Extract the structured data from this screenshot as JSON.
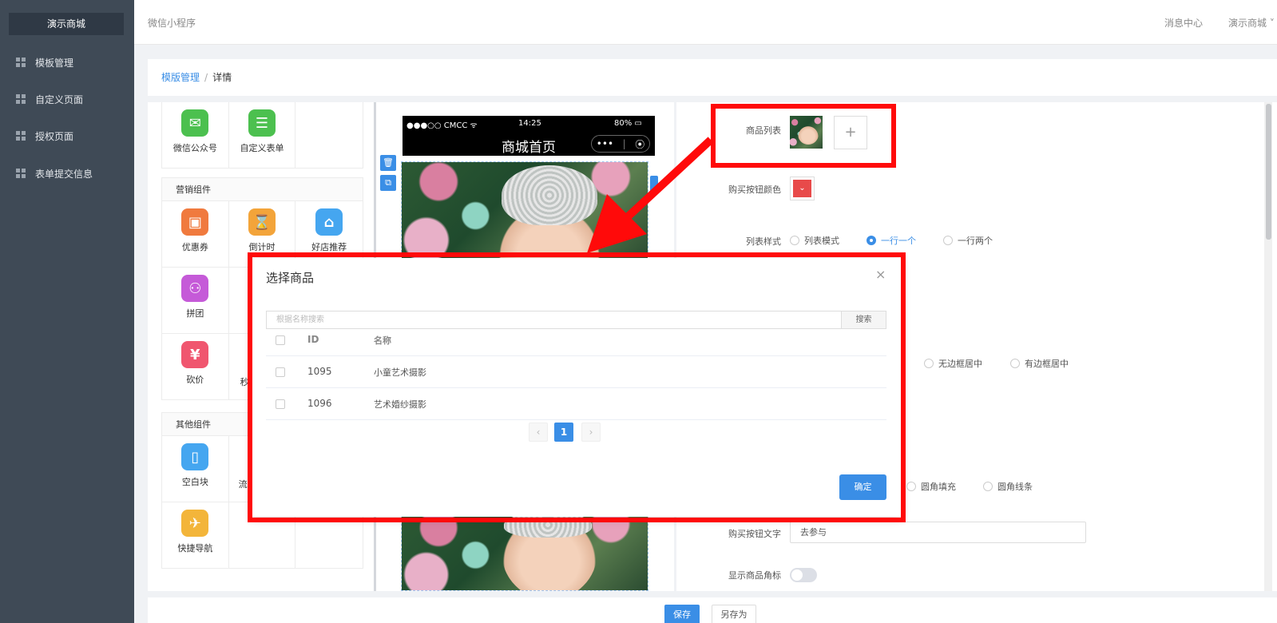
{
  "sidebar": {
    "brand": "演示商城",
    "items": [
      {
        "label": "模板管理"
      },
      {
        "label": "自定义页面"
      },
      {
        "label": "授权页面"
      },
      {
        "label": "表单提交信息"
      }
    ]
  },
  "header": {
    "app_name": "微信小程序",
    "message_center": "消息中心",
    "shop_menu": "演示商城 ˅"
  },
  "breadcrumb": {
    "parent": "模版管理",
    "separator": "/",
    "current": "详情"
  },
  "components": {
    "top_row": [
      {
        "label": "微信公众号",
        "icon": "wechat-icon",
        "color": "#4cc04f"
      },
      {
        "label": "自定义表单",
        "icon": "form-icon",
        "color": "#4cc04f"
      }
    ],
    "marketing_title": "营销组件",
    "marketing_rows": [
      [
        {
          "label": "优惠券",
          "icon": "coupon-icon",
          "color": "#f07a3e"
        },
        {
          "label": "倒计时",
          "icon": "hourglass-icon",
          "color": "#f3a43a"
        },
        {
          "label": "好店推荐",
          "icon": "shop-icon",
          "color": "#45a6f0"
        }
      ],
      [
        {
          "label": "拼团",
          "icon": "group-icon",
          "color": "#c55ad8"
        }
      ],
      [
        {
          "label": "砍价",
          "icon": "yen-icon",
          "color": "#f0566f"
        },
        {
          "label": "秒",
          "icon": "",
          "color": ""
        }
      ]
    ],
    "other_title": "其他组件",
    "other_rows": [
      [
        {
          "label": "空白块",
          "icon": "blank-icon",
          "color": "#45a6f0"
        },
        {
          "label": "流",
          "icon": "",
          "color": ""
        }
      ],
      [
        {
          "label": "快捷导航",
          "icon": "compass-icon",
          "color": "#f3b53a"
        }
      ]
    ]
  },
  "phone": {
    "carrier": "●●●○○ CMCC ᯤ",
    "time": "14:25",
    "battery": "80% ▭",
    "page_title": "商城首页",
    "capsule_more": "•••",
    "capsule_close": "⦿",
    "delete_icon": "🗑",
    "copy_icon": "⧉"
  },
  "config": {
    "goods_list_label": "商品列表",
    "add_symbol": "+",
    "buy_color_label": "购买按钮颜色",
    "buy_color": "#e84a4a",
    "list_style_label": "列表样式",
    "list_style_options": [
      "列表模式",
      "一行一个",
      "一行两个"
    ],
    "list_style_selected": "一行一个",
    "image_options": [
      "无边框居中",
      "有边框居中"
    ],
    "button_style_options": [
      "圆角填充",
      "圆角线条"
    ],
    "buy_text_label": "购买按钮文字",
    "buy_text_value": "去参与",
    "show_badge_label": "显示商品角标"
  },
  "footer": {
    "save": "保存",
    "save_as": "另存为"
  },
  "modal": {
    "title": "选择商品",
    "close": "×",
    "search_placeholder": "根据名称搜索",
    "search_button": "搜索",
    "columns": [
      "ID",
      "名称"
    ],
    "rows": [
      {
        "id": "1095",
        "name": "小童艺术摄影"
      },
      {
        "id": "1096",
        "name": "艺术婚纱摄影"
      }
    ],
    "pager": {
      "prev": "‹",
      "current": "1",
      "next": "›"
    },
    "confirm": "确定"
  },
  "colors": {
    "accent": "#3a8ee6",
    "annotation": "#ff0a0a",
    "sidebar_bg": "#3f4a56"
  }
}
